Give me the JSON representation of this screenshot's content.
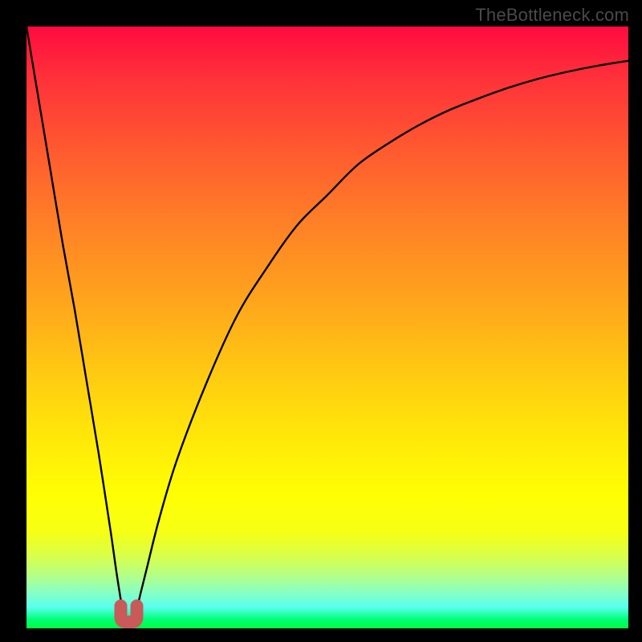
{
  "watermark": {
    "text": "TheBottleneck.com"
  },
  "chart_data": {
    "type": "line",
    "title": "",
    "xlabel": "",
    "ylabel": "",
    "xlim": [
      0,
      100
    ],
    "ylim": [
      0,
      100
    ],
    "grid": false,
    "legend": false,
    "series": [
      {
        "name": "bottleneck-percentage",
        "optimal_x": 17,
        "x": [
          0,
          2,
          4,
          6,
          8,
          10,
          12,
          14,
          15,
          16,
          17,
          18,
          19,
          20,
          22,
          25,
          30,
          35,
          40,
          45,
          50,
          55,
          60,
          65,
          70,
          75,
          80,
          85,
          90,
          95,
          100
        ],
        "y": [
          100,
          88,
          76,
          64,
          53,
          41,
          29,
          16,
          9,
          3,
          0,
          2,
          6,
          10,
          18,
          28,
          41,
          52,
          60,
          67,
          72,
          77,
          80.5,
          83.5,
          86,
          88,
          89.8,
          91.3,
          92.5,
          93.5,
          94.3
        ]
      }
    ],
    "background_gradient": {
      "orientation": "vertical",
      "stops": [
        {
          "pos": 0.0,
          "color": "#ff0a3f"
        },
        {
          "pos": 0.2,
          "color": "#ff5830"
        },
        {
          "pos": 0.45,
          "color": "#ffa31d"
        },
        {
          "pos": 0.68,
          "color": "#ffe709"
        },
        {
          "pos": 0.84,
          "color": "#f6ff14"
        },
        {
          "pos": 0.94,
          "color": "#88ffc3"
        },
        {
          "pos": 1.0,
          "color": "#00ff3e"
        }
      ]
    },
    "marker": {
      "x": 17,
      "y": 0,
      "shape": "u-shape",
      "color": "#c85a5a"
    },
    "annotations": []
  }
}
